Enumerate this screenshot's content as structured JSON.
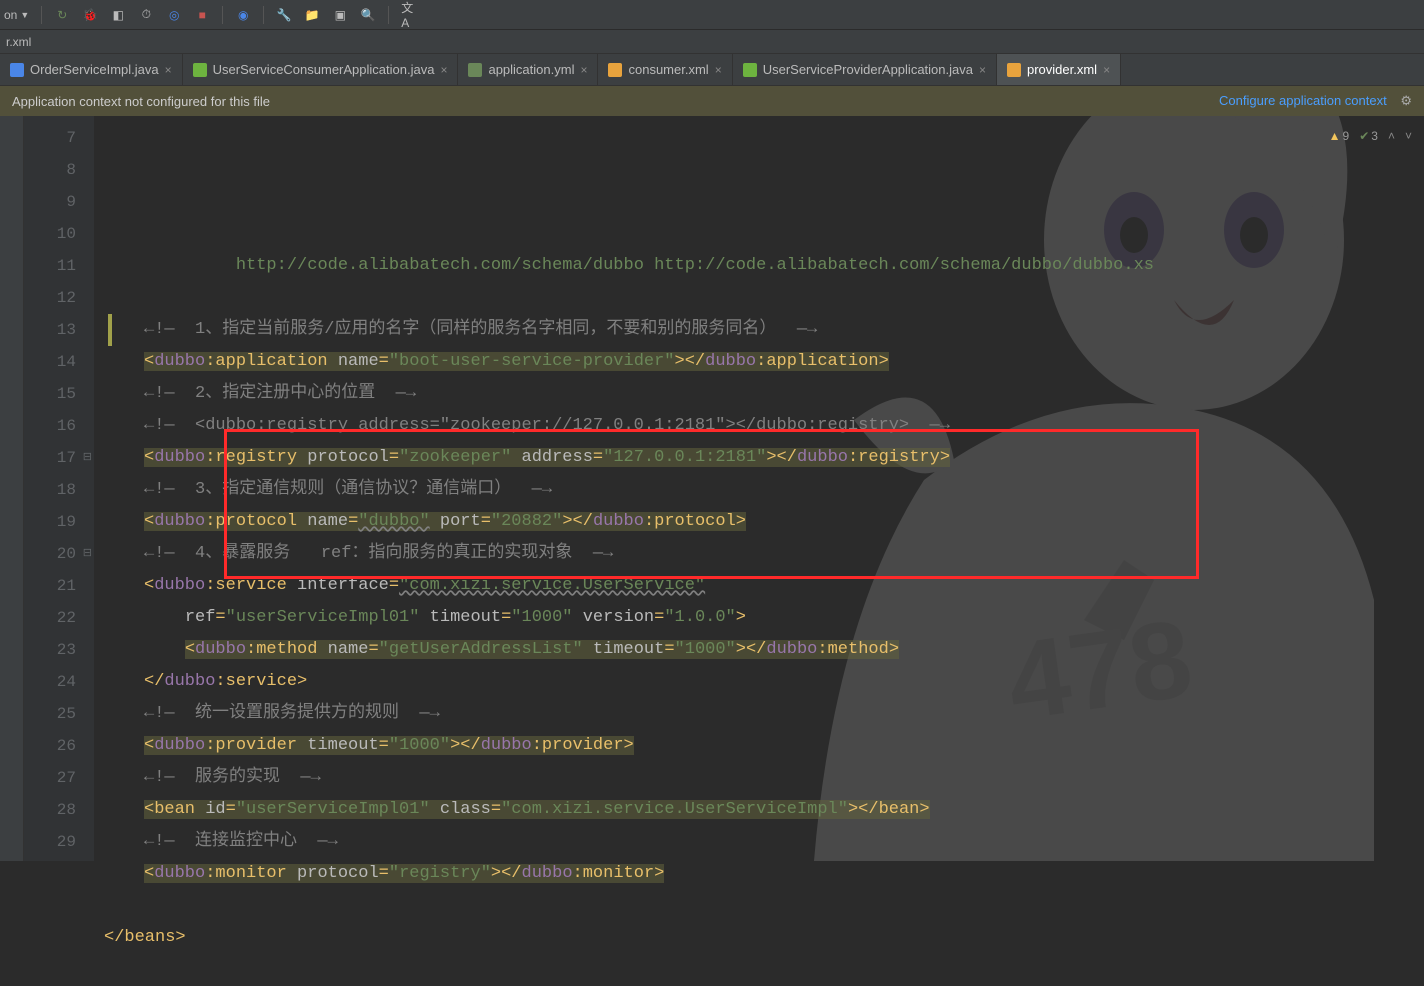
{
  "toolbar": {
    "dropdown": "on"
  },
  "breadcrumb": "r.xml",
  "tabs": [
    {
      "label": "OrderServiceImpl.java",
      "icon": "ic-java",
      "active": false
    },
    {
      "label": "UserServiceConsumerApplication.java",
      "icon": "ic-spring",
      "active": false
    },
    {
      "label": "application.yml",
      "icon": "ic-yml",
      "active": false
    },
    {
      "label": "consumer.xml",
      "icon": "ic-xml",
      "active": false
    },
    {
      "label": "UserServiceProviderApplication.java",
      "icon": "ic-spring",
      "active": false
    },
    {
      "label": "provider.xml",
      "icon": "ic-xml",
      "active": true
    }
  ],
  "banner": {
    "message": "Application context not configured for this file",
    "action": "Configure application context"
  },
  "gutter_start": 7,
  "gutter_end": 29,
  "inspections": {
    "warnings": "9",
    "oks": "3"
  },
  "code": {
    "l7": {
      "url1": "http://code.alibabatech.com/schema/dubbo",
      "url2": "http://code.alibabatech.com/schema/dubbo/dubbo.xs"
    },
    "l9": {
      "c": "1、指定当前服务/应用的名字（同样的服务名字相同，不要和别的服务同名）"
    },
    "l10": {
      "tag": "dubbo:application",
      "attr": "name",
      "val": "boot-user-service-provider"
    },
    "l11": {
      "c": "2、指定注册中心的位置"
    },
    "l12": {
      "c": "<dubbo:registry address=\"zookeeper://127.0.0.1:2181\"></dubbo:registry>"
    },
    "l13": {
      "tag": "dubbo:registry",
      "a1": "protocol",
      "v1": "zookeeper",
      "a2": "address",
      "v2": "127.0.0.1:2181"
    },
    "l14": {
      "c": "3、指定通信规则（通信协议？通信端口）"
    },
    "l15": {
      "tag": "dubbo:protocol",
      "a1": "name",
      "v1": "dubbo",
      "a2": "port",
      "v2": "20882"
    },
    "l16": {
      "c": "4、暴露服务   ref：指向服务的真正的实现对象"
    },
    "l17": {
      "tag": "dubbo:service",
      "a1": "interface",
      "v1": "com.xizi.service.UserService"
    },
    "l18": {
      "a1": "ref",
      "v1": "userServiceImpl01",
      "a2": "timeout",
      "v2": "1000",
      "a3": "version",
      "v3": "1.0.0"
    },
    "l19": {
      "tag": "dubbo:method",
      "a1": "name",
      "v1": "getUserAddressList",
      "a2": "timeout",
      "v2": "1000"
    },
    "l20": {
      "close": "dubbo:service"
    },
    "l21": {
      "c": "统一设置服务提供方的规则"
    },
    "l22": {
      "tag": "dubbo:provider",
      "a1": "timeout",
      "v1": "1000"
    },
    "l23": {
      "c": "服务的实现"
    },
    "l24": {
      "tag": "bean",
      "a1": "id",
      "v1": "userServiceImpl01",
      "a2": "class",
      "v2": "com.xizi.service.UserServiceImpl"
    },
    "l25": {
      "c": "连接监控中心"
    },
    "l26": {
      "tag": "dubbo:monitor",
      "a1": "protocol",
      "v1": "registry"
    },
    "l28": {
      "close": "beans"
    }
  }
}
